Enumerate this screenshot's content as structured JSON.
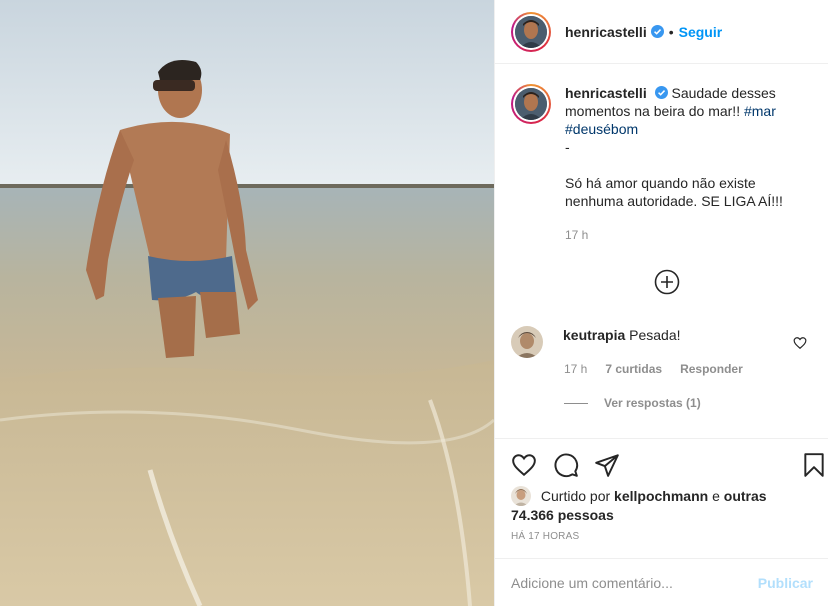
{
  "post": {
    "username": "henricastelli",
    "follow_label": "Seguir",
    "separator": "•",
    "caption_text": "Saudade desses momentos na beira do mar!!",
    "hashtags": [
      "#mar",
      "#deusébom"
    ],
    "caption_dash": "-",
    "caption_line2": "Só há amor quando não existe nenhuma autoridade. SE LIGA AÍ!!!",
    "caption_time": "17 h"
  },
  "comment": {
    "username": "keutrapia",
    "text": "Pesada!",
    "time": "17 h",
    "likes": "7 curtidas",
    "reply_label": "Responder",
    "view_replies": "Ver respostas (1)"
  },
  "likes": {
    "prefix": "Curtido por",
    "user": "kellpochmann",
    "connector": "e",
    "others": "outras 74.366 pessoas"
  },
  "timestamp": "HÁ 17 HORAS",
  "composer": {
    "placeholder": "Adicione um comentário...",
    "publish_label": "Publicar"
  },
  "icons": {
    "verified": "verified-badge-icon",
    "like": "heart-icon",
    "comment": "comment-icon",
    "share": "paper-plane-icon",
    "save": "bookmark-icon",
    "load_more": "plus-circle-icon"
  },
  "colors": {
    "link_blue": "#0095f6",
    "hashtag": "#00376b",
    "muted": "#8e8e8e",
    "publish_disabled": "#b2dffc"
  }
}
